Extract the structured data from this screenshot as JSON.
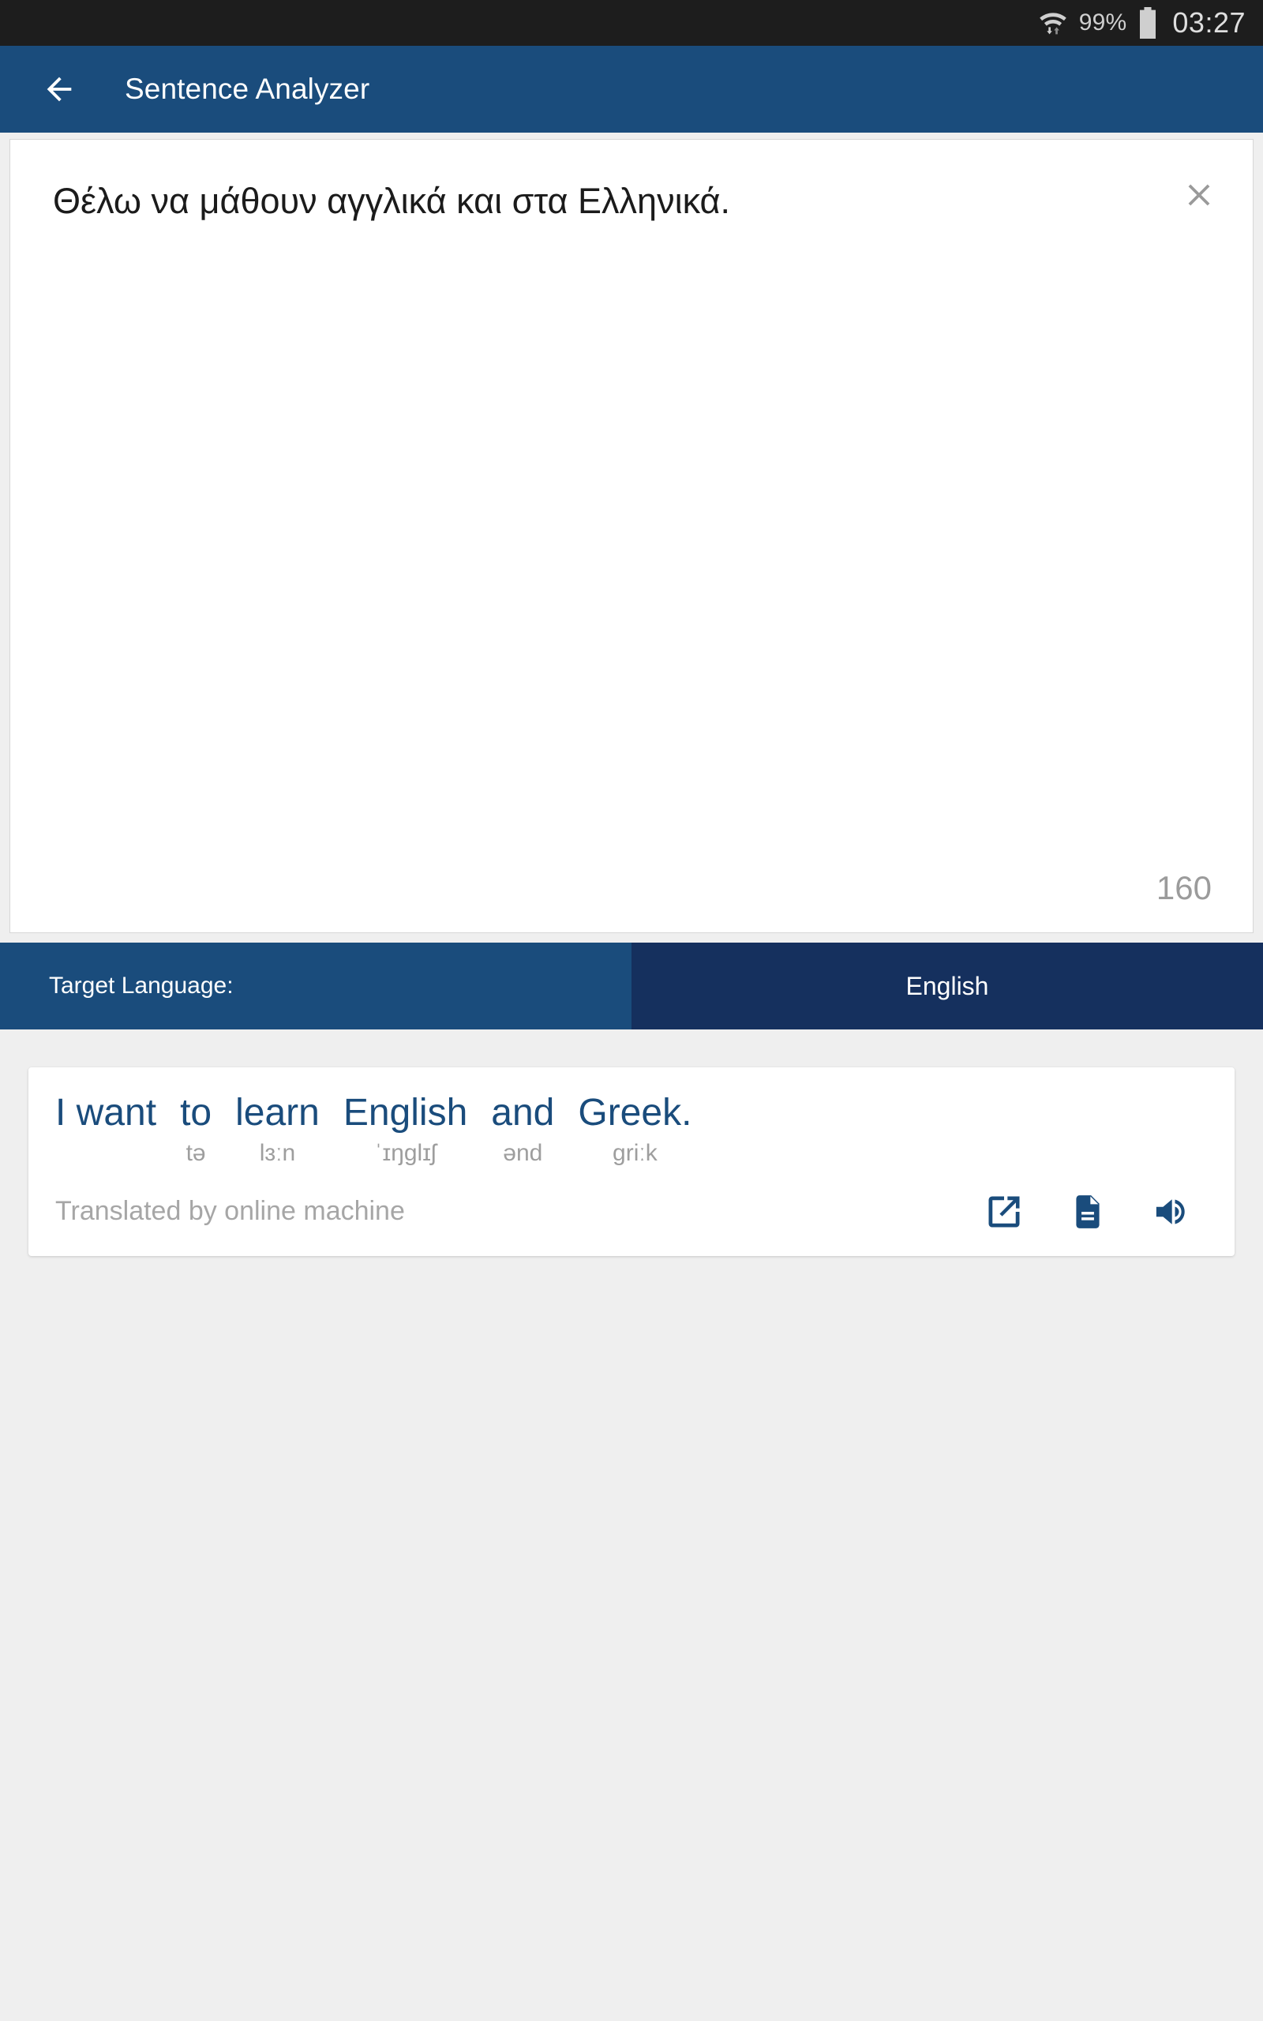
{
  "status_bar": {
    "wifi_icon": "wifi-with-transfer-arrows-icon",
    "battery_percent": "99%",
    "battery_icon": "battery-full-icon",
    "time": "03:27",
    "background": "#1d1d1d"
  },
  "app_bar": {
    "back_icon": "back-arrow-icon",
    "title": "Sentence Analyzer",
    "background": "#1a4c7c",
    "text_color": "#ffffff"
  },
  "input_card": {
    "source_text": "Θέλω να μάθουν αγγλικά και στα Ελληνικά.",
    "clear_icon": "close-x-icon",
    "char_count": "160",
    "background": "#ffffff",
    "text_color": "#1b1b1b",
    "counter_color": "#9b9b9b"
  },
  "target_language": {
    "label": "Target Language:",
    "value": "English",
    "label_background": "#1a4c7c",
    "value_background": "#15305e"
  },
  "result_card": {
    "tokens": [
      {
        "word": "I want",
        "phonetic": ""
      },
      {
        "word": "to",
        "phonetic": "tə"
      },
      {
        "word": "learn",
        "phonetic": "lɜːn"
      },
      {
        "word": "English",
        "phonetic": "ˈɪŋglɪʃ"
      },
      {
        "word": "and",
        "phonetic": "ənd"
      },
      {
        "word": "Greek.",
        "phonetic": "griːk"
      }
    ],
    "full_translation": "I want to learn English and Greek.",
    "source_note": "Translated by online machine",
    "word_color": "#1a4c7c",
    "phonetic_color": "#9e9e9e",
    "note_color": "#a6a6a6",
    "actions": [
      {
        "name": "open-in-new-icon",
        "label": "Open in new"
      },
      {
        "name": "document-icon",
        "label": "Document"
      },
      {
        "name": "speaker-icon",
        "label": "Speak"
      }
    ]
  },
  "page": {
    "background": "#efefef"
  }
}
